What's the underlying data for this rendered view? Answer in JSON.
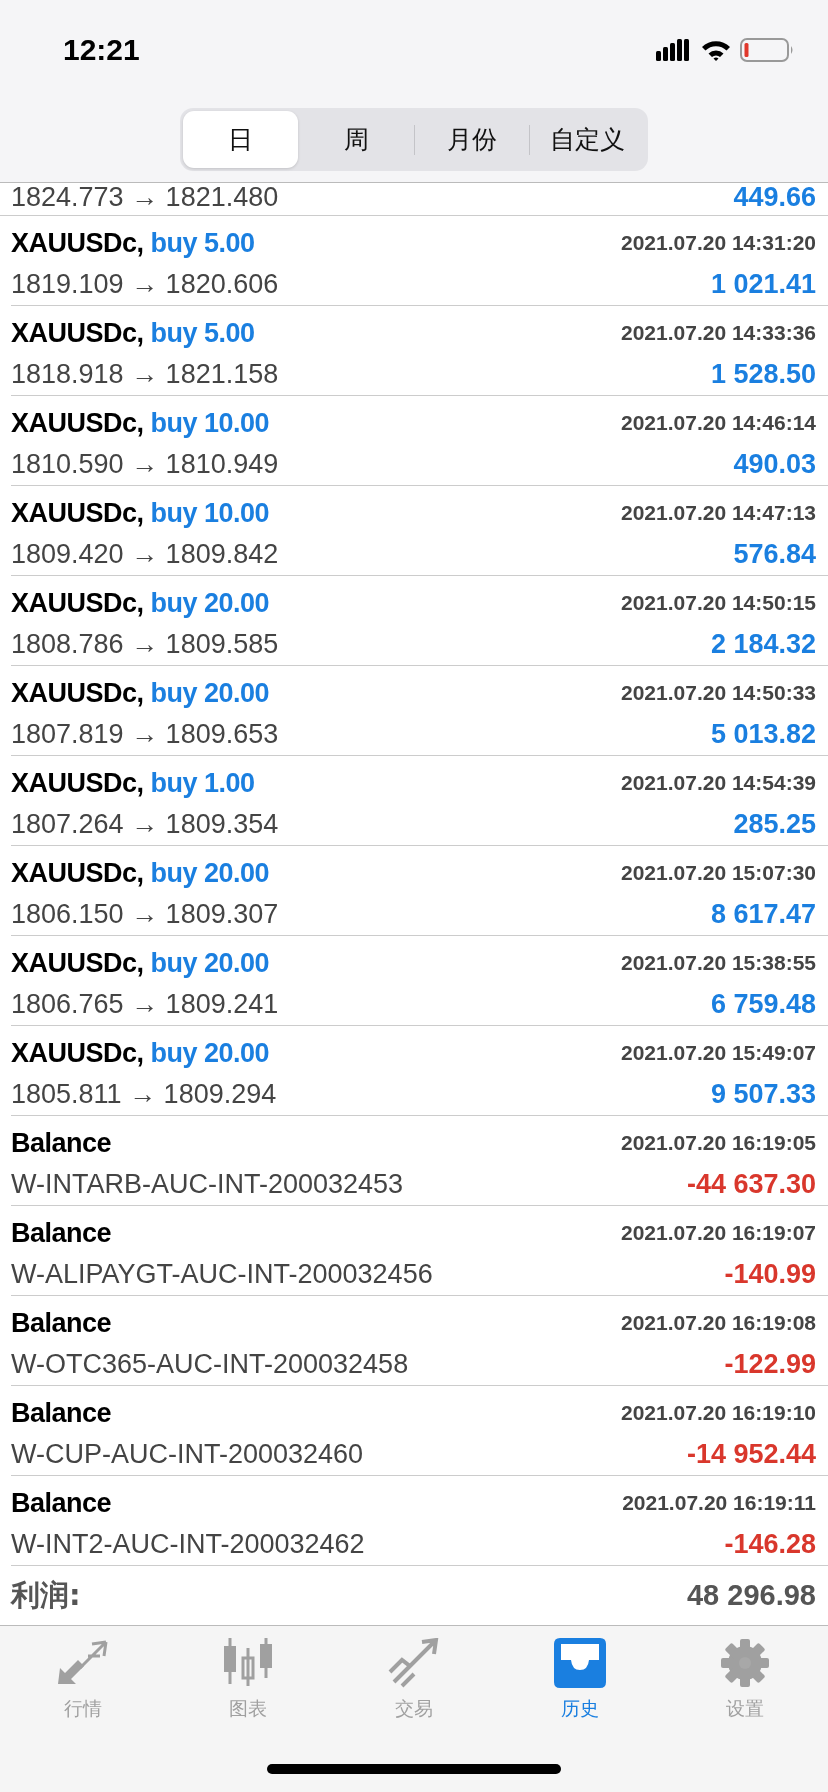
{
  "status_bar": {
    "time": "12:21"
  },
  "tabs": [
    {
      "label": "日",
      "selected": true
    },
    {
      "label": "周",
      "selected": false
    },
    {
      "label": "月份",
      "selected": false
    },
    {
      "label": "自定义",
      "selected": false
    }
  ],
  "partial_row": {
    "prices": "1824.773 → 1821.480",
    "profit": "449.66",
    "loss": false
  },
  "rows": [
    {
      "kind": "trade",
      "symbol": "XAUUSDc,",
      "order": "buy 5.00",
      "time": "2021.07.20 14:31:20",
      "detail": "1819.109 → 1820.606",
      "profit": "1 021.41",
      "loss": false
    },
    {
      "kind": "trade",
      "symbol": "XAUUSDc,",
      "order": "buy 5.00",
      "time": "2021.07.20 14:33:36",
      "detail": "1818.918 → 1821.158",
      "profit": "1 528.50",
      "loss": false
    },
    {
      "kind": "trade",
      "symbol": "XAUUSDc,",
      "order": "buy 10.00",
      "time": "2021.07.20 14:46:14",
      "detail": "1810.590 → 1810.949",
      "profit": "490.03",
      "loss": false
    },
    {
      "kind": "trade",
      "symbol": "XAUUSDc,",
      "order": "buy 10.00",
      "time": "2021.07.20 14:47:13",
      "detail": "1809.420 → 1809.842",
      "profit": "576.84",
      "loss": false
    },
    {
      "kind": "trade",
      "symbol": "XAUUSDc,",
      "order": "buy 20.00",
      "time": "2021.07.20 14:50:15",
      "detail": "1808.786 → 1809.585",
      "profit": "2 184.32",
      "loss": false
    },
    {
      "kind": "trade",
      "symbol": "XAUUSDc,",
      "order": "buy 20.00",
      "time": "2021.07.20 14:50:33",
      "detail": "1807.819 → 1809.653",
      "profit": "5 013.82",
      "loss": false
    },
    {
      "kind": "trade",
      "symbol": "XAUUSDc,",
      "order": "buy 1.00",
      "time": "2021.07.20 14:54:39",
      "detail": "1807.264 → 1809.354",
      "profit": "285.25",
      "loss": false
    },
    {
      "kind": "trade",
      "symbol": "XAUUSDc,",
      "order": "buy 20.00",
      "time": "2021.07.20 15:07:30",
      "detail": "1806.150 → 1809.307",
      "profit": "8 617.47",
      "loss": false
    },
    {
      "kind": "trade",
      "symbol": "XAUUSDc,",
      "order": "buy 20.00",
      "time": "2021.07.20 15:38:55",
      "detail": "1806.765 → 1809.241",
      "profit": "6 759.48",
      "loss": false
    },
    {
      "kind": "trade",
      "symbol": "XAUUSDc,",
      "order": "buy 20.00",
      "time": "2021.07.20 15:49:07",
      "detail": "1805.811 → 1809.294",
      "profit": "9 507.33",
      "loss": false
    },
    {
      "kind": "balance",
      "symbol": "Balance",
      "time": "2021.07.20 16:19:05",
      "detail": "W-INTARB-AUC-INT-200032453",
      "profit": "-44 637.30",
      "loss": true
    },
    {
      "kind": "balance",
      "symbol": "Balance",
      "time": "2021.07.20 16:19:07",
      "detail": "W-ALIPAYGT-AUC-INT-200032456",
      "profit": "-140.99",
      "loss": true
    },
    {
      "kind": "balance",
      "symbol": "Balance",
      "time": "2021.07.20 16:19:08",
      "detail": "W-OTC365-AUC-INT-200032458",
      "profit": "-122.99",
      "loss": true
    },
    {
      "kind": "balance",
      "symbol": "Balance",
      "time": "2021.07.20 16:19:10",
      "detail": "W-CUP-AUC-INT-200032460",
      "profit": "-14 952.44",
      "loss": true
    },
    {
      "kind": "balance",
      "symbol": "Balance",
      "time": "2021.07.20 16:19:11",
      "detail": "W-INT2-AUC-INT-200032462",
      "profit": "-146.28",
      "loss": true
    }
  ],
  "total": {
    "label": "利润:",
    "value": "48 296.98"
  },
  "nav": [
    {
      "kind": "quotes",
      "label": "行情",
      "selected": false
    },
    {
      "kind": "chart",
      "label": "图表",
      "selected": false
    },
    {
      "kind": "trade",
      "label": "交易",
      "selected": false
    },
    {
      "kind": "history",
      "label": "历史",
      "selected": true
    },
    {
      "kind": "settings",
      "label": "设置",
      "selected": false
    }
  ]
}
